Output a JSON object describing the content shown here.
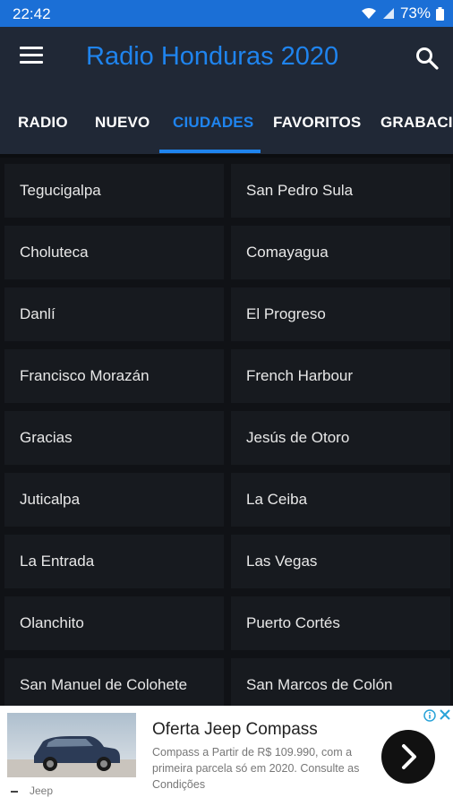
{
  "status": {
    "time": "22:42",
    "battery": "73%"
  },
  "appbar": {
    "title": "Radio Honduras 2020"
  },
  "tabs": [
    {
      "label": "RADIO"
    },
    {
      "label": "NUEVO"
    },
    {
      "label": "CIUDADES"
    },
    {
      "label": "FAVORITOS"
    },
    {
      "label": "GRABACIÓ"
    }
  ],
  "active_tab": "CIUDADES",
  "cities": [
    "Tegucigalpa",
    "San Pedro Sula",
    "Choluteca",
    "Comayagua",
    "Danlí",
    "El Progreso",
    "Francisco Morazán",
    "French Harbour",
    "Gracias",
    "Jesús de Otoro",
    "Juticalpa",
    "La Ceiba",
    "La Entrada",
    "Las Vegas",
    "Olanchito",
    "Puerto Cortés",
    "San Manuel de Colohete",
    "San Marcos de Colón"
  ],
  "ad": {
    "headline": "Oferta Jeep Compass",
    "body": "Compass a Partir de R$ 109.990, com a primeira parcela só em 2020. Consulte as Condições",
    "brand": "Jeep"
  },
  "colors": {
    "accent": "#1f84ee",
    "status_bar": "#1b6fd6",
    "app_bar": "#202836",
    "cell_bg": "#171a1f"
  },
  "icons": {
    "menu": "hamburger-menu-icon",
    "search": "search-icon",
    "cta": "chevron-right-icon",
    "info": "info-icon",
    "close": "close-icon"
  }
}
